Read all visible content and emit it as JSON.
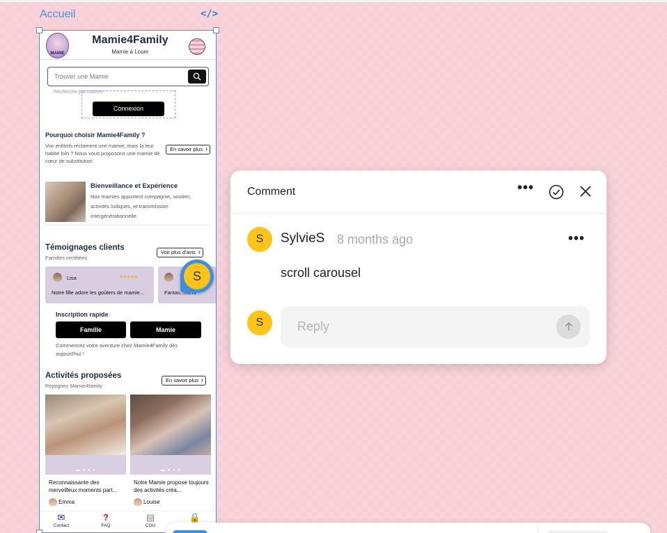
{
  "canvas": {
    "frame_label": "Accueil",
    "code_icon": "code-icon"
  },
  "phone": {
    "header": {
      "logo_text": "MAMIE",
      "brand": "Mamie4Family",
      "tagline": "Mamie à Louer"
    },
    "search": {
      "placeholder": "Trouver une Mamie",
      "advanced_label": "Recherche par critères",
      "login_button": "Connexion"
    },
    "why": {
      "title": "Pourquoi choisir Mamie4Family ?",
      "text": "Vos enfants réclament une mamie, mais la leur habite loin ? Nous vous proposons une mamie de cœur de substitution",
      "button": "En savoir plus"
    },
    "benevolence": {
      "title": "Bienveillance et Expérience",
      "text": "Nos mamies apportent compagnie, soutien, activités ludiques, et transmission intergénérationnelle."
    },
    "testimonials": {
      "title": "Témoignages clients",
      "subtitle": "Familles certifiées",
      "button": "Voir plus d'avis",
      "cards": [
        {
          "name": "Lisa",
          "stars": "★★★★★",
          "text": "Notre fille adore les goûters de mamie..."
        },
        {
          "name": "",
          "stars": "",
          "text": "Fantas...ment"
        }
      ]
    },
    "signup": {
      "title": "Inscription rapide",
      "family_button": "Famille",
      "mamie_button": "Mamie",
      "text": "Commencez votre aventure chez Mamie4Family dès aujourd'hui !"
    },
    "activities": {
      "title": "Activités proposées",
      "subtitle": "Rejoignez Mamie4family",
      "button": "En savoir plus",
      "cards": [
        {
          "text": "Reconnaissante des merveilleux moments part...",
          "user": "Emma"
        },
        {
          "text": "Notre Mamie propose toujours des activités créa...",
          "user": "Louise"
        }
      ]
    },
    "nav": [
      {
        "label": "Contact",
        "icon": "mail-icon"
      },
      {
        "label": "FAQ",
        "icon": "question-icon"
      },
      {
        "label": "CGU",
        "icon": "scroll-icon"
      },
      {
        "label": "",
        "icon": "lock-icon"
      }
    ]
  },
  "comment_badge": {
    "initial": "S"
  },
  "comment_panel": {
    "title": "Comment",
    "author_initial": "S",
    "author": "SylvieS",
    "time": "8 months ago",
    "body": "scroll carousel",
    "reply_placeholder": "Reply",
    "reply_initial": "S"
  },
  "colors": {
    "canvas_bg": "#f6cfd7",
    "selection": "#4a90e2",
    "avatar": "#fcc419",
    "card_lilac": "#d9cde2"
  }
}
